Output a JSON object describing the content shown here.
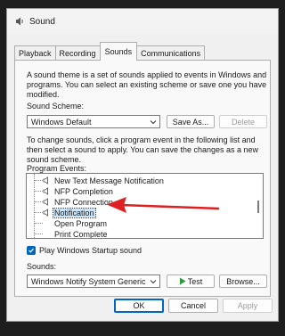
{
  "window": {
    "title": "Sound",
    "tabs": [
      {
        "label": "Playback",
        "active": false
      },
      {
        "label": "Recording",
        "active": false
      },
      {
        "label": "Sounds",
        "active": true
      },
      {
        "label": "Communications",
        "active": false
      }
    ]
  },
  "sounds": {
    "intro": "A sound theme is a set of sounds applied to events in Windows and programs.  You can select an existing scheme or save one you have modified.",
    "scheme_label": "Sound Scheme:",
    "scheme_value": "Windows Default",
    "save_as_label": "Save As...",
    "delete_label": "Delete",
    "instructions": "To change sounds, click a program event in the following list and then select a sound to apply.  You can save the changes as a new sound scheme.",
    "events_label": "Program Events:",
    "events": [
      {
        "label": "New Text Message Notification",
        "has_sound": true,
        "selected": false,
        "indent": 1
      },
      {
        "label": "NFP Completion",
        "has_sound": true,
        "selected": false,
        "indent": 1
      },
      {
        "label": "NFP Connection",
        "has_sound": true,
        "selected": false,
        "indent": 1
      },
      {
        "label": "Notification",
        "has_sound": true,
        "selected": true,
        "indent": 1
      },
      {
        "label": "Open Program",
        "has_sound": false,
        "selected": false,
        "indent": 1
      },
      {
        "label": "Print Complete",
        "has_sound": false,
        "selected": false,
        "indent": 1
      }
    ],
    "startup_label": "Play Windows Startup sound",
    "startup_checked": true,
    "sounds_label": "Sounds:",
    "sound_value": "Windows Notify System Generic",
    "test_label": "Test",
    "browse_label": "Browse..."
  },
  "footer": {
    "ok_label": "OK",
    "cancel_label": "Cancel",
    "apply_label": "Apply"
  },
  "colors": {
    "accent": "#0067c0",
    "annotation_arrow": "#e02020",
    "selection": "#cce4f7"
  }
}
